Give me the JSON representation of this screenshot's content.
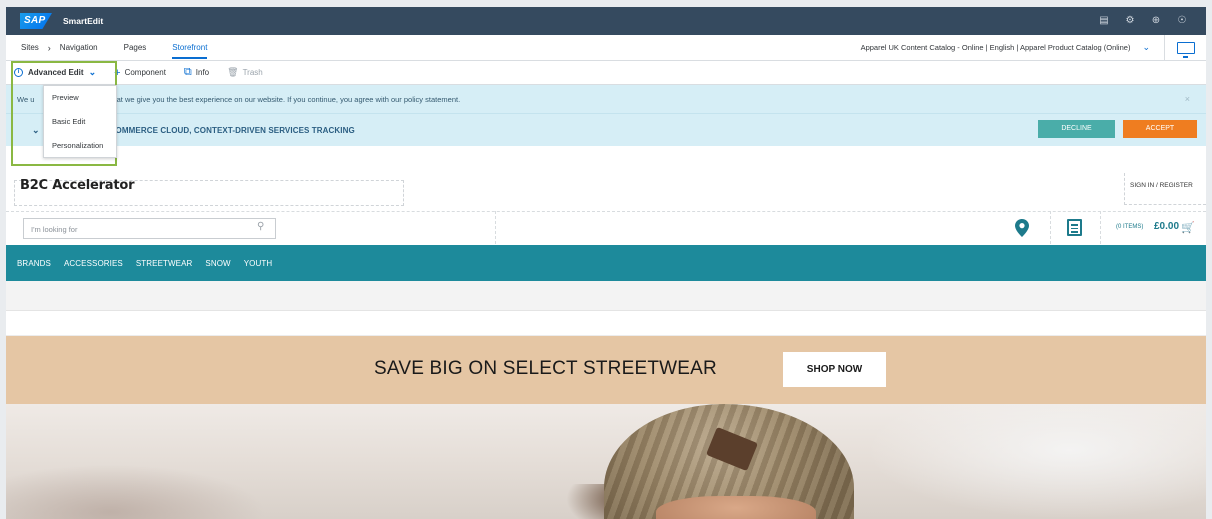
{
  "shell": {
    "logo": "SAP",
    "app_name": "SmartEdit",
    "icons": [
      "notes-icon",
      "settings-icon",
      "globe-icon",
      "user-icon"
    ]
  },
  "nav": {
    "crumb_sites": "Sites",
    "crumb_navigation": "Navigation",
    "crumb_pages": "Pages",
    "crumb_storefront": "Storefront",
    "catalog_label": "Apparel UK Content Catalog - Online | English | Apparel Product Catalog (Online)"
  },
  "toolbar": {
    "mode": "Advanced Edit",
    "component": "Component",
    "info": "Info",
    "trash": "Trash"
  },
  "mode_menu": {
    "options": [
      "Preview",
      "Basic Edit",
      "Personalization"
    ]
  },
  "storefront": {
    "cookie_message_left": "We u",
    "cookie_message": "that we give you the best experience on our website. If you continue, you agree with our policy statement.",
    "tracking_title": "OMMERCE CLOUD, CONTEXT-DRIVEN SERVICES TRACKING",
    "decline": "DECLINE",
    "accept": "ACCEPT",
    "site_logo": "B2C Accelerator",
    "signin": "SIGN IN / REGISTER",
    "search_placeholder": "I'm looking for",
    "cart_items": "(0 ITEMS)",
    "cart_total": "£0.00",
    "categories": [
      "BRANDS",
      "ACCESSORIES",
      "STREETWEAR",
      "SNOW",
      "YOUTH"
    ],
    "promo_text": "SAVE BIG ON SELECT STREETWEAR",
    "shop_now": "SHOP NOW"
  },
  "colors": {
    "shell_bg": "#354a5f",
    "accent": "#0a6ed1",
    "teal_nav": "#1d8a9b",
    "decline": "#4aada9",
    "accept": "#ef7d20",
    "promo_bg": "#e5c6a4",
    "mode_highlight": "#8ab843"
  }
}
